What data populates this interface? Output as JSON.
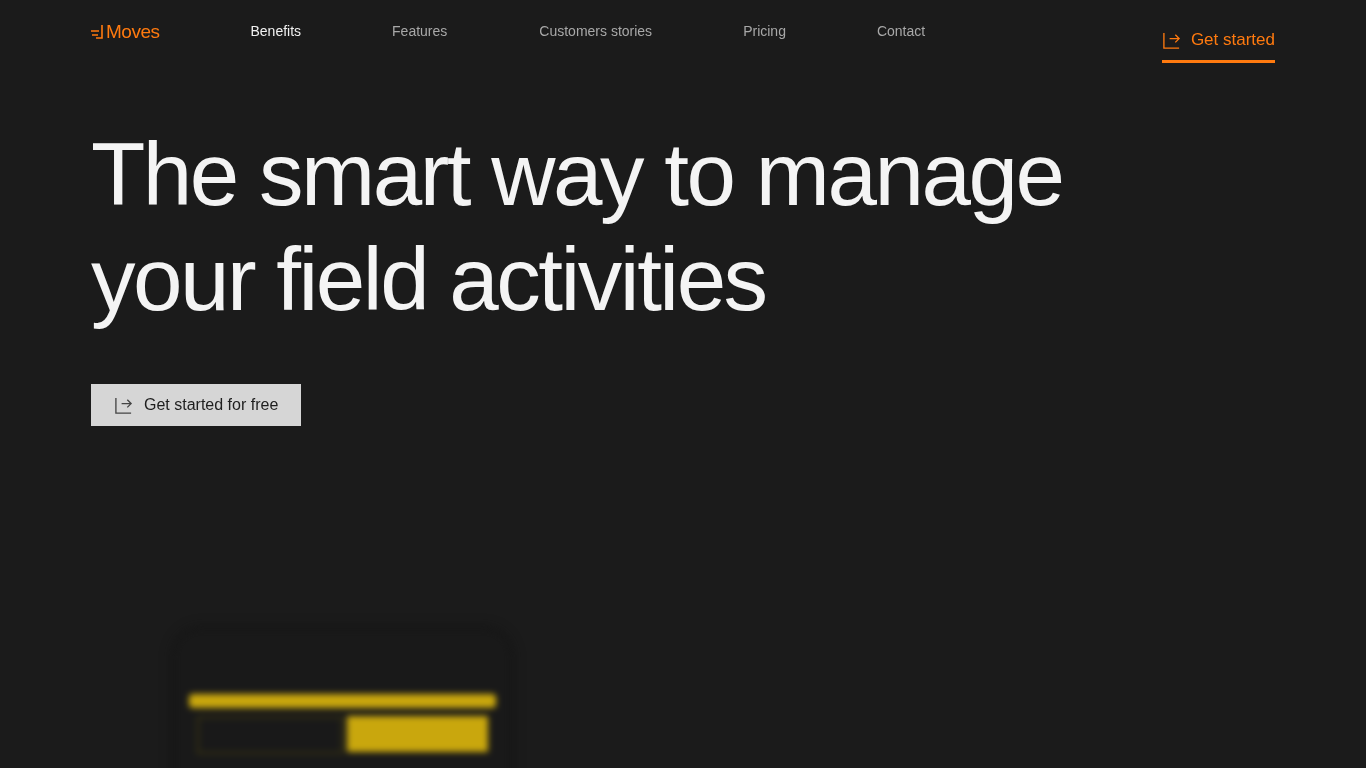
{
  "logo": "Moves",
  "nav": [
    {
      "label": "Benefits",
      "selected": true
    },
    {
      "label": "Features",
      "selected": false
    },
    {
      "label": "Customers stories",
      "selected": false
    },
    {
      "label": "Pricing",
      "selected": false
    },
    {
      "label": "Contact",
      "selected": false
    }
  ],
  "header_cta": "Get started",
  "headline": [
    "The smart way to manage",
    "your field activities"
  ],
  "hero_cta": "Get started for free"
}
